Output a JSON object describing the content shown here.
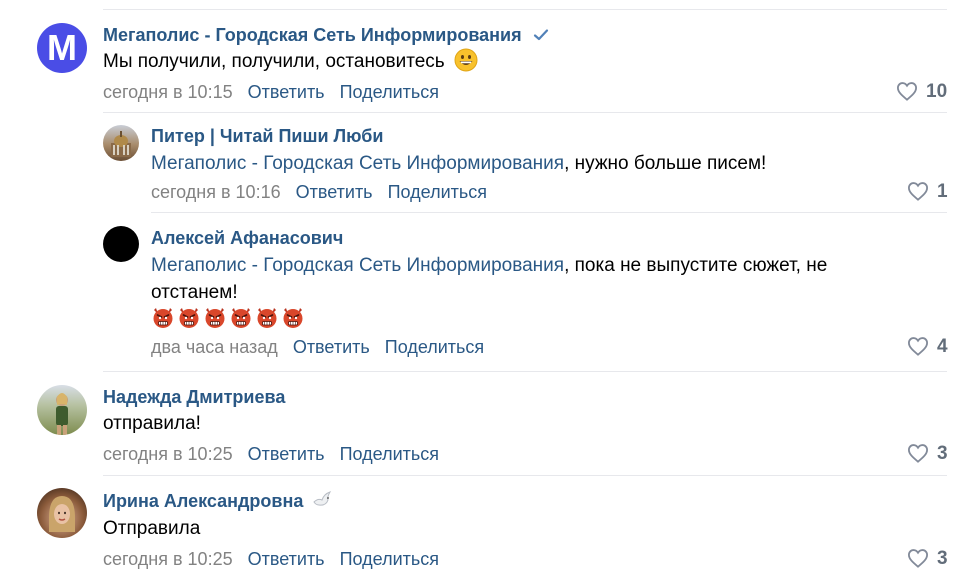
{
  "comments": [
    {
      "author": "Мегаполис - Городская Сеть Информирования",
      "verified": true,
      "avatar_letter": "M",
      "text": "Мы получили, получили, остановитесь",
      "date": "сегодня в 10:15",
      "reply_label": "Ответить",
      "share_label": "Поделиться",
      "likes": "10"
    },
    {
      "author": "Питер | Читай Пиши Люби",
      "mention": "Мегаполис - Городская Сеть Информирования",
      "text": ", нужно больше писем!",
      "date": "сегодня в 10:16",
      "reply_label": "Ответить",
      "share_label": "Поделиться",
      "likes": "1"
    },
    {
      "author": "Алексей Афанасович",
      "mention": "Мегаполис - Городская Сеть Информирования",
      "text_line1": ", пока не выпустите сюжет, не",
      "text_line2": "отстанем!",
      "emoji_count": 6,
      "date": "два часа назад",
      "reply_label": "Ответить",
      "share_label": "Поделиться",
      "likes": "4"
    },
    {
      "author": "Надежда Дмитриева",
      "text": "отправила!",
      "date": "сегодня в 10:25",
      "reply_label": "Ответить",
      "share_label": "Поделиться",
      "likes": "3"
    },
    {
      "author": "Ирина Александровна",
      "text": "Отправила",
      "date": "сегодня в 10:25",
      "reply_label": "Ответить",
      "share_label": "Поделиться",
      "likes": "3"
    }
  ],
  "colors": {
    "link": "#2a5885",
    "meta": "#828282",
    "megapolis_avatar": "#4a4de6",
    "divider": "#e7e8ec"
  }
}
